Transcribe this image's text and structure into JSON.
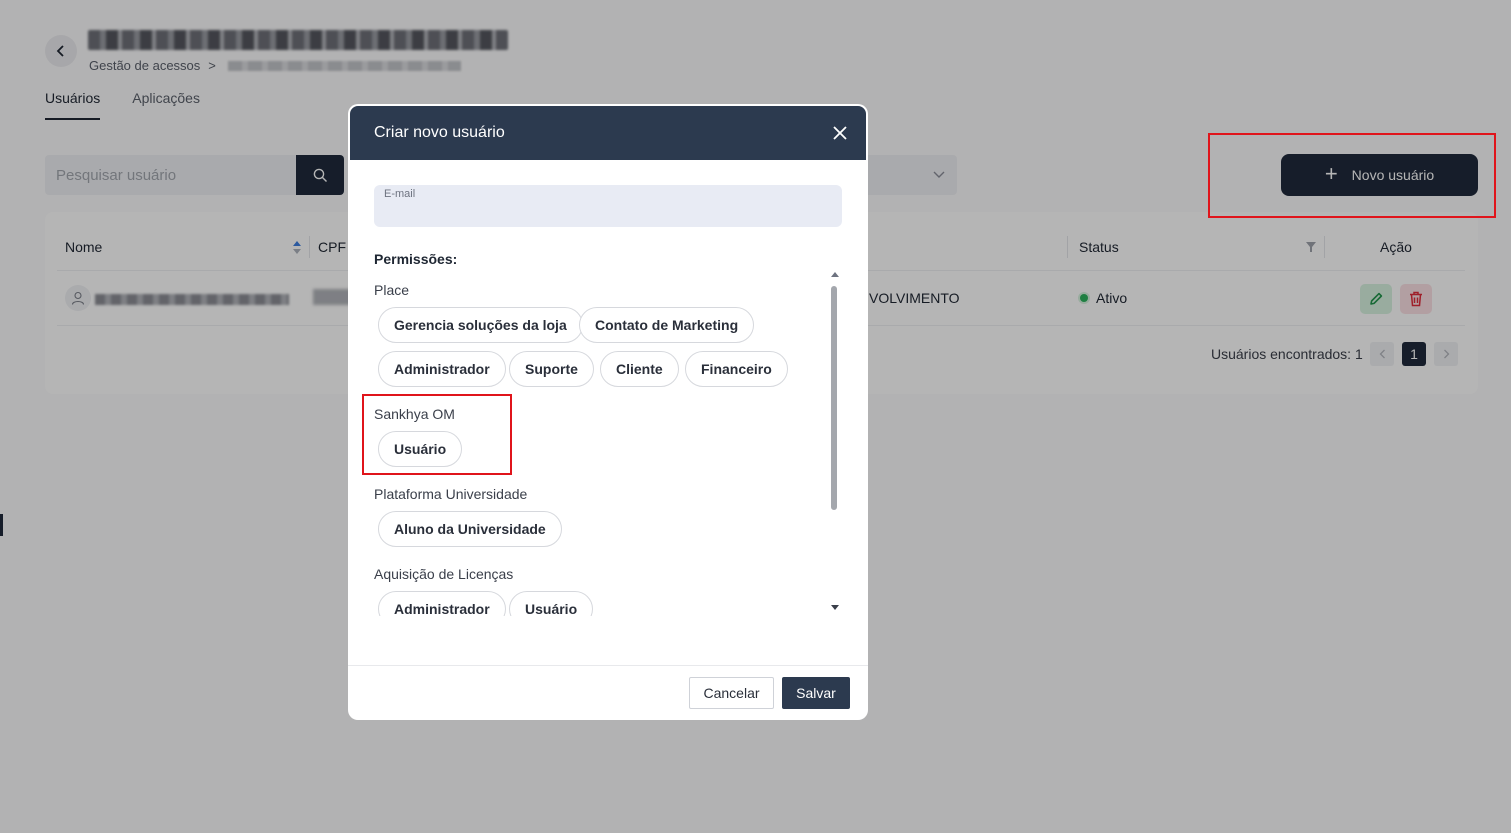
{
  "header": {
    "breadcrumb_root": "Gestão de acessos",
    "breadcrumb_separator": ">"
  },
  "tabs": [
    {
      "label": "Usuários",
      "active": true
    },
    {
      "label": "Aplicações",
      "active": false
    }
  ],
  "search": {
    "placeholder": "Pesquisar usuário",
    "value": ""
  },
  "new_user_button": {
    "label": "Novo usuário"
  },
  "table": {
    "columns": [
      "Nome",
      "CPF",
      "Status",
      "Ação"
    ],
    "rows": [
      {
        "environment": "VOLVIMENTO",
        "status": "Ativo"
      }
    ],
    "found_label": "Usuários encontrados: 1",
    "current_page": "1"
  },
  "modal": {
    "title": "Criar novo usuário",
    "email_label": "E-mail",
    "email_value": "",
    "permissions_title": "Permissões:",
    "groups": [
      {
        "label": "Place",
        "chips": [
          "Gerencia soluções da loja",
          "Contato de Marketing",
          "Administrador",
          "Suporte",
          "Cliente",
          "Financeiro"
        ]
      },
      {
        "label": "Sankhya OM",
        "chips": [
          "Usuário"
        ]
      },
      {
        "label": "Plataforma Universidade",
        "chips": [
          "Aluno da Universidade"
        ]
      },
      {
        "label": "Aquisição de Licenças",
        "chips": [
          "Administrador",
          "Usuário"
        ]
      }
    ],
    "cancel_label": "Cancelar",
    "save_label": "Salvar"
  },
  "colors": {
    "primary_dark": "#1f2a3c",
    "modal_header": "#2c3a4f",
    "highlight_red": "#e0141b",
    "status_green": "#2db35d"
  },
  "icons": [
    "chevron-left-icon",
    "search-icon",
    "chevron-down-icon",
    "plus-icon",
    "sort-icon",
    "filter-icon",
    "user-icon",
    "edit-icon",
    "trash-icon",
    "close-icon"
  ]
}
